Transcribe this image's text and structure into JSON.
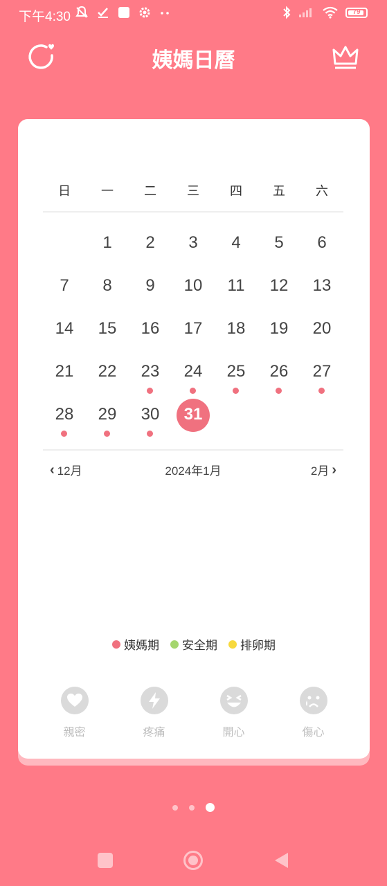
{
  "status_bar": {
    "time": "下午4:30",
    "battery": "79"
  },
  "header": {
    "title": "姨媽日曆"
  },
  "calendar": {
    "weekdays": [
      "日",
      "一",
      "二",
      "三",
      "四",
      "五",
      "六"
    ],
    "leading_blanks": 1,
    "days": [
      {
        "n": "1",
        "dot": false,
        "today": false
      },
      {
        "n": "2",
        "dot": false,
        "today": false
      },
      {
        "n": "3",
        "dot": false,
        "today": false
      },
      {
        "n": "4",
        "dot": false,
        "today": false
      },
      {
        "n": "5",
        "dot": false,
        "today": false
      },
      {
        "n": "6",
        "dot": false,
        "today": false
      },
      {
        "n": "7",
        "dot": false,
        "today": false
      },
      {
        "n": "8",
        "dot": false,
        "today": false
      },
      {
        "n": "9",
        "dot": false,
        "today": false
      },
      {
        "n": "10",
        "dot": false,
        "today": false
      },
      {
        "n": "11",
        "dot": false,
        "today": false
      },
      {
        "n": "12",
        "dot": false,
        "today": false
      },
      {
        "n": "13",
        "dot": false,
        "today": false
      },
      {
        "n": "14",
        "dot": false,
        "today": false
      },
      {
        "n": "15",
        "dot": false,
        "today": false
      },
      {
        "n": "16",
        "dot": false,
        "today": false
      },
      {
        "n": "17",
        "dot": false,
        "today": false
      },
      {
        "n": "18",
        "dot": false,
        "today": false
      },
      {
        "n": "19",
        "dot": false,
        "today": false
      },
      {
        "n": "20",
        "dot": false,
        "today": false
      },
      {
        "n": "21",
        "dot": false,
        "today": false
      },
      {
        "n": "22",
        "dot": false,
        "today": false
      },
      {
        "n": "23",
        "dot": true,
        "today": false
      },
      {
        "n": "24",
        "dot": true,
        "today": false
      },
      {
        "n": "25",
        "dot": true,
        "today": false
      },
      {
        "n": "26",
        "dot": true,
        "today": false
      },
      {
        "n": "27",
        "dot": true,
        "today": false
      },
      {
        "n": "28",
        "dot": true,
        "today": false
      },
      {
        "n": "29",
        "dot": true,
        "today": false
      },
      {
        "n": "30",
        "dot": true,
        "today": false
      },
      {
        "n": "31",
        "dot": false,
        "today": true
      }
    ],
    "prev_month": "12月",
    "current_month": "2024年1月",
    "next_month": "2月"
  },
  "legend": [
    {
      "label": "姨媽期",
      "color": "#F0717F"
    },
    {
      "label": "安全期",
      "color": "#A5D66E"
    },
    {
      "label": "排卵期",
      "color": "#F7D93D"
    }
  ],
  "moods": [
    {
      "label": "親密",
      "icon": "heart-icon"
    },
    {
      "label": "疼痛",
      "icon": "lightning-icon"
    },
    {
      "label": "開心",
      "icon": "laughing-face-icon"
    },
    {
      "label": "傷心",
      "icon": "crying-face-icon"
    }
  ],
  "colors": {
    "background": "#FF7A87",
    "accent": "#F0717F",
    "card": "#FFFFFF"
  },
  "pager": {
    "count": 3,
    "active": 2
  }
}
